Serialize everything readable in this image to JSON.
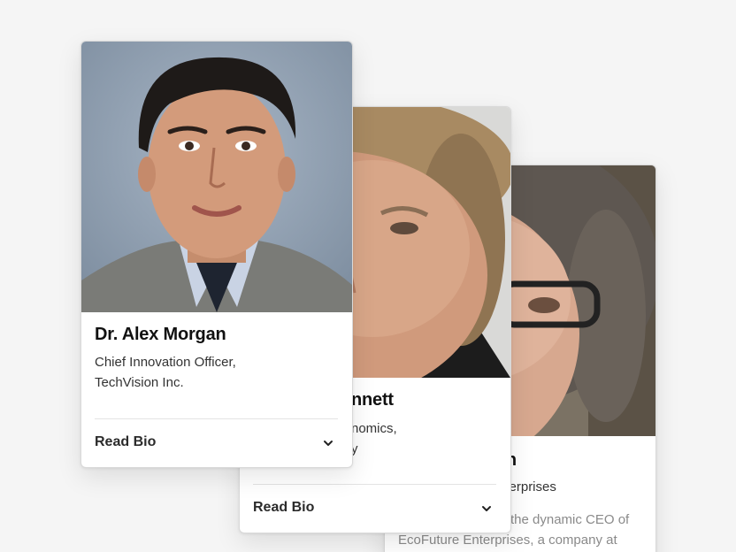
{
  "cards": [
    {
      "name": "Dr. Alex Morgan",
      "role_line1": "Chief Innovation Officer,",
      "role_line2": "TechVision Inc.",
      "read_bio": "Read Bio"
    },
    {
      "name": "nnett",
      "role_line1": "nomics,",
      "role_line2": "y",
      "read_bio": "Read Bio"
    },
    {
      "name": "en",
      "role_line1": "nterprises",
      "bio_line1": "the dynamic CEO of",
      "bio_line2": "EcoFuture Enterprises, a company at"
    }
  ],
  "icons": {
    "expand": "chevron-down-icon"
  },
  "colors": {
    "background": "#f5f5f5",
    "card": "#ffffff",
    "text": "#111111",
    "muted": "#8a8a8a"
  }
}
